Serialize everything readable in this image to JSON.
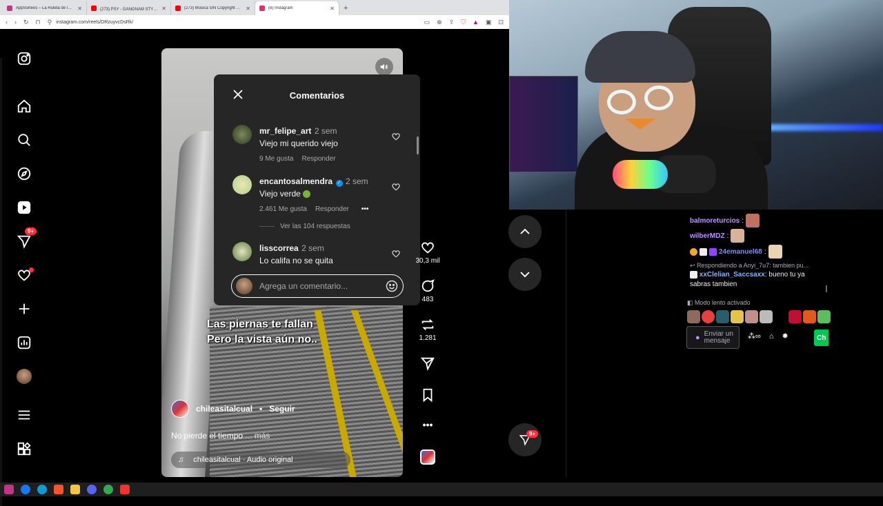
{
  "browser": {
    "tabs": [
      {
        "label": "AppSorteos – La Ruleta de la Suerte",
        "color": "#c13584"
      },
      {
        "label": "(273) PSY - GANGNAM STYLE(강남스",
        "color": "#ff0000"
      },
      {
        "label": "(273) Música SIN Copyright 2025 (#",
        "color": "#ff0000"
      },
      {
        "label": "(8) Instagram",
        "color": "#e1306c"
      }
    ],
    "url": "instagram.com/reels/DRzuyvcDsRk/"
  },
  "sidebar": {
    "home": "home",
    "badge_notifications": "9+"
  },
  "video": {
    "overlay_line1": "Las piernas te fallan",
    "overlay_line2": "Pero la vista aún no..",
    "author": "chileasitalcual",
    "follow_label": "Seguir",
    "bullet": "•",
    "caption": "No pierde el tiempo",
    "caption_more": "... más",
    "audio": "chileasitalcual · Audio original"
  },
  "comments": {
    "title": "Comentarios",
    "items": [
      {
        "user": "mr_felipe_art",
        "time": "2 sem",
        "text": "Viejo mi querido viejo",
        "likes": "9 Me gusta",
        "reply": "Responder",
        "avatar_color": "#4a5a3a"
      },
      {
        "user": "encantosalmendra",
        "time": "2 sem",
        "text": "Viejo verde",
        "likes": "2.461 Me gusta",
        "reply": "Responder",
        "avatar_color": "#a9d18e",
        "verified": true
      },
      {
        "user": "lisscorrea",
        "time": "2 sem",
        "text": "Lo califa no se quita",
        "avatar_color": "#5b7d3e"
      }
    ],
    "view_replies": "Ver las 104 respuestas",
    "input_placeholder": "Agrega un comentario..."
  },
  "actions": {
    "likes": "30,3 mil",
    "comments": "483",
    "reposts": "1.281",
    "badge": "9+"
  },
  "chat": {
    "m1_user": "balmoreturcios",
    "m2_user": "wilberMDZ",
    "m3_user": "24emanuel68",
    "reply_to": "Respondiendo a Anyi_7u7: tambien pu...",
    "m4_user": "xxClelian_Saccsaxx",
    "m4_text": ": bueno tu ya sabras tambien",
    "colon": ":",
    "slow_mode": "Modo lento activado",
    "input_placeholder": "Enviar un mensaje",
    "chat_button": "Ch"
  },
  "colors": {
    "accent_purple": "#bf94ff",
    "chat_green": "#00c853",
    "ig_badge": "#ff3040"
  }
}
